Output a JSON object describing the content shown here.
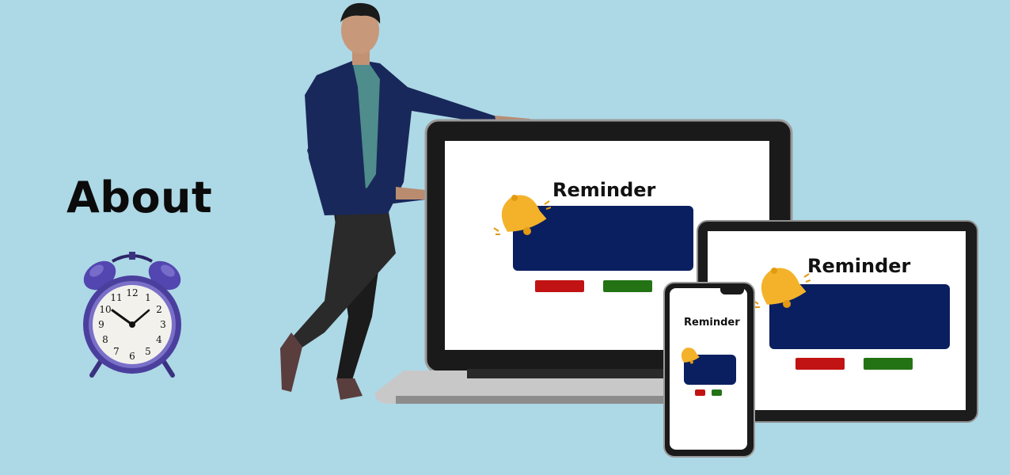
{
  "page": {
    "title": "About"
  },
  "laptop": {
    "reminder_title": "Reminder"
  },
  "tablet": {
    "reminder_title": "Reminder"
  },
  "phone": {
    "reminder_title": "Reminder"
  },
  "icons": {
    "clock": "alarm-clock-icon",
    "bell": "bell-icon"
  },
  "colors": {
    "background": "#add8e6",
    "reminder_box": "#0a1f60",
    "button_red": "#c11313",
    "button_green": "#237315",
    "bell": "#f3b22a",
    "clock_body": "#4b3f9e"
  }
}
